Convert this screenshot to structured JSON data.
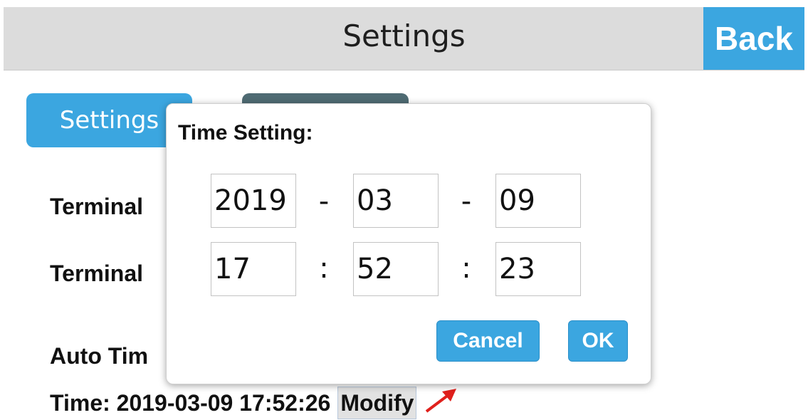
{
  "header": {
    "title": "Settings",
    "back_label": "Back"
  },
  "tabs": [
    {
      "label": "Settings"
    },
    {
      "label": ""
    }
  ],
  "rows": {
    "terminal_1": "Terminal",
    "terminal_2": "Terminal",
    "auto_time": "Auto Tim"
  },
  "time_line": {
    "text": "Time: 2019-03-09 17:52:26",
    "modify_label": "Modify"
  },
  "dialog": {
    "title": "Time Setting:",
    "year": "2019",
    "month": "03",
    "day": "09",
    "hour": "17",
    "minute": "52",
    "second": "23",
    "date_sep": "-",
    "time_sep": ":",
    "cancel_label": "Cancel",
    "ok_label": "OK"
  },
  "colors": {
    "accent": "#3ba6e0",
    "tab_dark": "#4f6b73",
    "header_bg": "#dcdcdc",
    "arrow": "#e0201c"
  }
}
